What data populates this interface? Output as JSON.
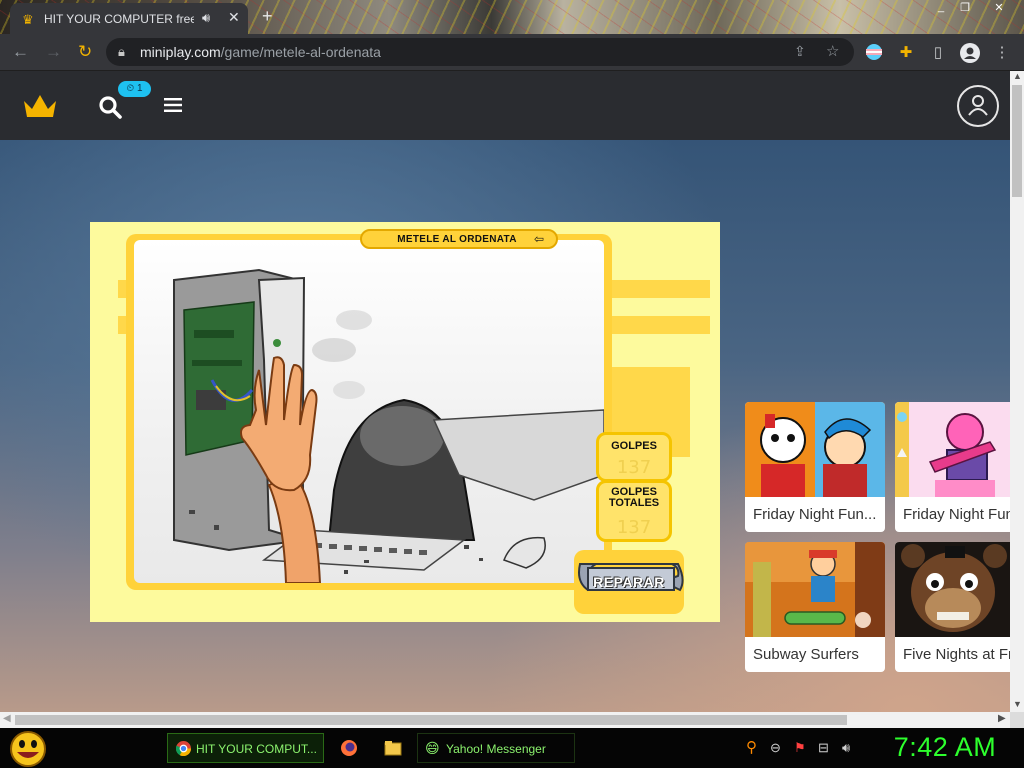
{
  "browser": {
    "tab": {
      "title": "HIT YOUR COMPUTER free o",
      "favicon": "crown-icon"
    },
    "new_tab_label": "+",
    "window_controls": [
      "_",
      "❐",
      "✕"
    ],
    "address": {
      "host": "miniplay.com",
      "path": "/game/metele-al-ordenata"
    }
  },
  "site_header": {
    "history_badge": "⏲ 1"
  },
  "game": {
    "title": "METELE AL ORDENATA",
    "hits_label": "GOLPES",
    "hits_value": "137",
    "total_hits_label": "GOLPES TOTALES",
    "total_hits_value": "137",
    "repair_label": "REPARAR"
  },
  "game_cards": [
    {
      "title": "Friday Night Fun...",
      "thumb": "fnf-cuphead"
    },
    {
      "title": "Friday Night Fun",
      "thumb": "fnf-pink"
    },
    {
      "title": "Subway Surfers",
      "thumb": "subway-surfers"
    },
    {
      "title": "Five Nights at Fr",
      "thumb": "fnaf"
    }
  ],
  "taskbar": {
    "tasks": [
      {
        "label": "HIT YOUR COMPUT...",
        "icon": "chrome-icon"
      },
      {
        "label": "Yahoo! Messenger",
        "icon": "yahoo-messenger-icon"
      }
    ],
    "clock": "7:42 AM"
  },
  "colors": {
    "accent": "#f2b300",
    "badge": "#1ec1f0",
    "clock": "#2dff2d",
    "game_bg": "#fdfa9d"
  }
}
